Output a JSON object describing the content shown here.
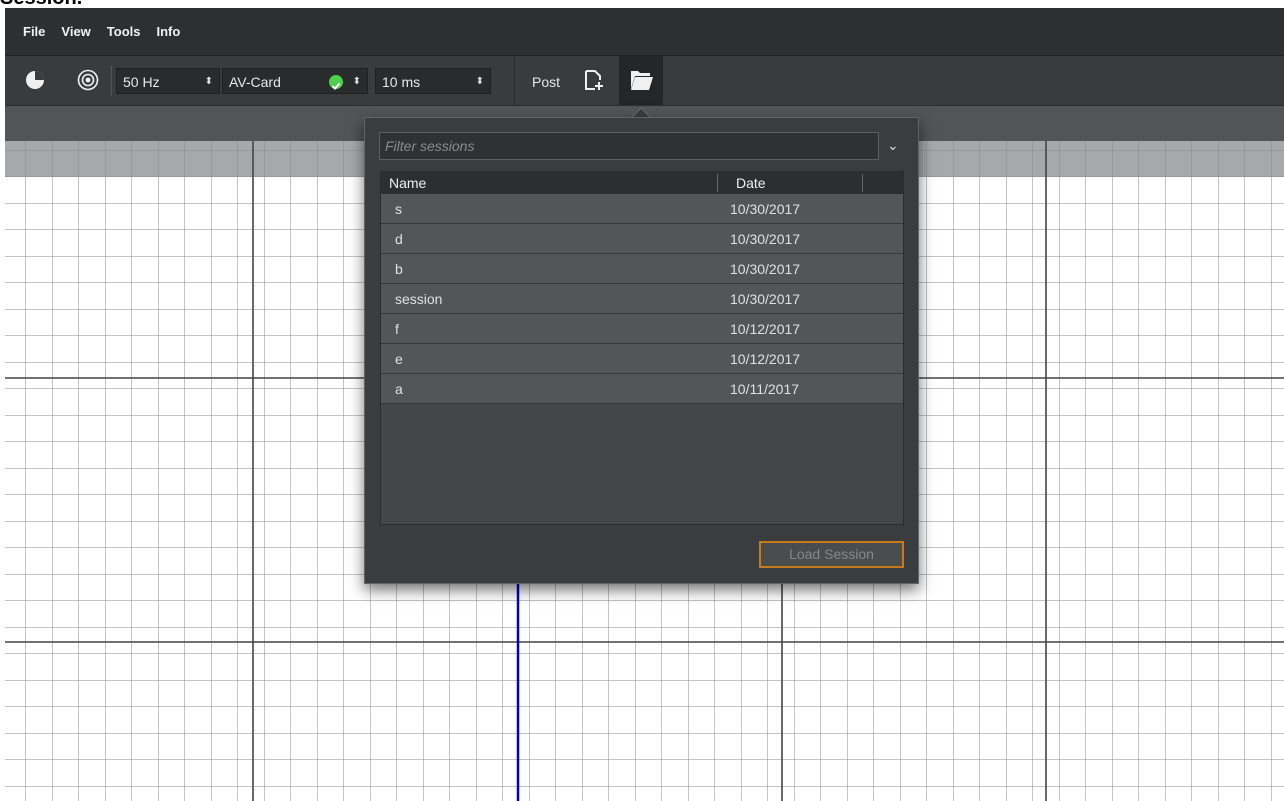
{
  "top_text": "Session.",
  "menu": [
    "File",
    "View",
    "Tools",
    "Info"
  ],
  "toolbar": {
    "freq": "50 Hz",
    "device": "AV-Card",
    "interval": "10 ms",
    "post_label": "Post",
    "icons": [
      "clock-icon",
      "target-icon",
      "status-ok-icon",
      "new-session-icon",
      "open-folder-icon"
    ]
  },
  "popup": {
    "filter_placeholder": "Filter sessions",
    "columns": [
      "Name",
      "Date"
    ],
    "rows": [
      {
        "name": "s",
        "date": "10/30/2017"
      },
      {
        "name": "d",
        "date": "10/30/2017"
      },
      {
        "name": "b",
        "date": "10/30/2017"
      },
      {
        "name": "session",
        "date": "10/30/2017"
      },
      {
        "name": "f",
        "date": "10/12/2017"
      },
      {
        "name": "e",
        "date": "10/12/2017"
      },
      {
        "name": "a",
        "date": "10/11/2017"
      }
    ],
    "load_label": "Load Session"
  },
  "colors": {
    "menubar": "#2e2f30",
    "toolbar": "#3a3b3c",
    "popup_bg": "#3b3c3d",
    "accent_border": "#c77a1c",
    "marker_line": "#0000cc",
    "ok_green": "#4fcf4f"
  }
}
